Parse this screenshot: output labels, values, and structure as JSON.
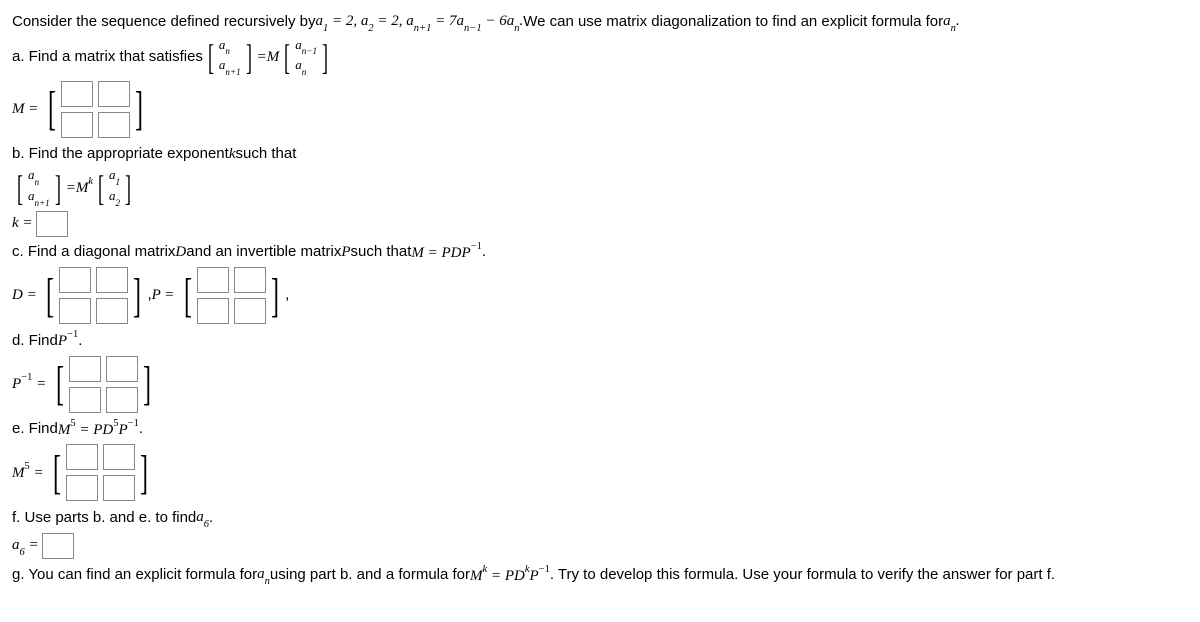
{
  "intro": "Consider the sequence defined recursively by ",
  "intro_eq": "a₁ = 2, a₂ = 2, aₙ₊₁ = 7aₙ₋₁ − 6aₙ.",
  "intro_tail": " We can use matrix diagonalization to find an explicit formula for ",
  "intro_tail2": "aₙ.",
  "a_text": "a. Find a matrix that satisfies ",
  "a_eq_mid": " = ",
  "M_var": "M",
  "M_eq": "M = ",
  "b_text": "b. Find the appropriate exponent ",
  "b_k": "k",
  "b_text2": " such that",
  "b_eq_mid": " = ",
  "Mk": "M",
  "Mk_sup": "k",
  "k_eq": "k = ",
  "c_text": "c. Find a diagonal matrix ",
  "c_D": "D",
  "c_text2": " and an invertible matrix ",
  "c_P": "P",
  "c_text3": " such that ",
  "c_eq": "M = PDP",
  "c_eq_sup": "−1",
  "c_dot": ".",
  "D_eq": "D = ",
  "comma": ", ",
  "P_eq": "P = ",
  "d_text": "d. Find ",
  "d_P": "P",
  "d_sup": "−1",
  "d_dot": ".",
  "Pinv_eq_left": "P",
  "Pinv_eq_sup": "−1",
  "Pinv_eq_right": " = ",
  "e_text": "e. Find ",
  "e_M": "M",
  "e_sup": "5",
  "e_eq": " = PD",
  "e_sup2": "5",
  "e_P": "P",
  "e_sup3": "−1",
  "e_dot": ".",
  "M5_left": "M",
  "M5_sup": "5",
  "M5_right": " = ",
  "f_text": "f. Use parts b. and e. to find ",
  "f_a6": "a₆",
  "f_dot": ".",
  "a6_eq": "a₆ = ",
  "g_text": "g. You can find an explicit formula for ",
  "g_an": "aₙ",
  "g_text2": " using part b. and a formula for ",
  "g_Mk": "M",
  "g_Mk_sup": "k",
  "g_eq": " = PD",
  "g_sup2": "k",
  "g_P": "P",
  "g_sup3": "−1",
  "g_text3": ". Try to develop this formula. Use your formula to verify the answer for part f.",
  "vec_an": "aₙ",
  "vec_anp1": "aₙ₊₁",
  "vec_anm1": "aₙ₋₁",
  "vec_a1": "a₁",
  "vec_a2": "a₂"
}
